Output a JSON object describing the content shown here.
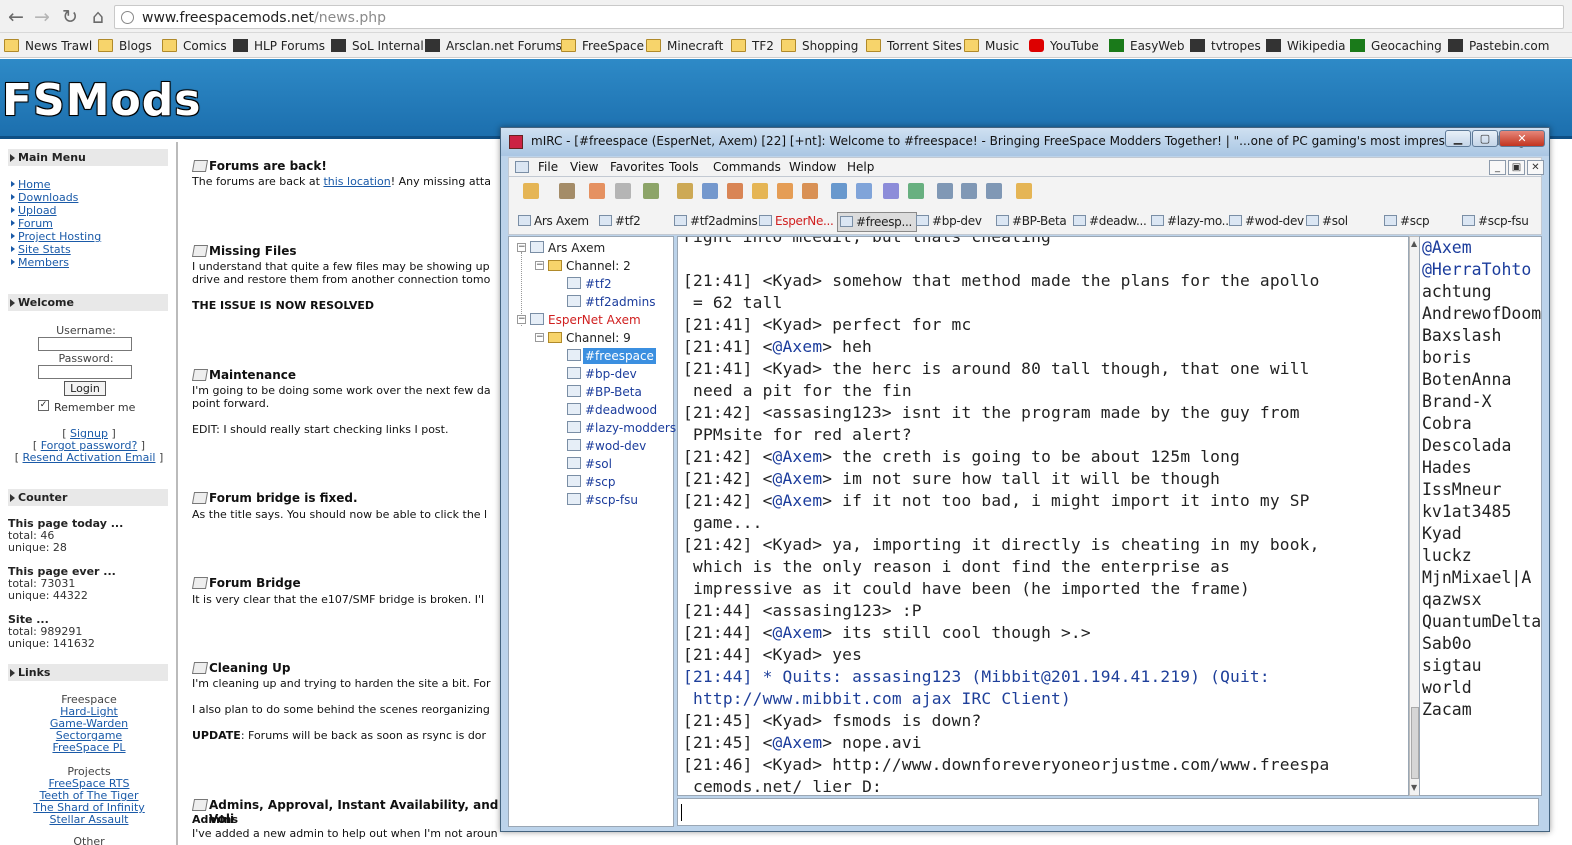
{
  "browser": {
    "url_host": "www.freespacemods.net",
    "url_path": "/news.php",
    "bookmarks": [
      {
        "label": "News Trawl",
        "icon": "folder-icon"
      },
      {
        "label": "Blogs",
        "icon": "folder-icon"
      },
      {
        "label": "Comics",
        "icon": "folder-icon"
      },
      {
        "label": "HLP Forums",
        "icon": "hlp-icon"
      },
      {
        "label": "SoL Internal",
        "icon": "sol-icon"
      },
      {
        "label": "Arsclan.net Forums",
        "icon": "arsclan-icon"
      },
      {
        "label": "FreeSpace",
        "icon": "folder-icon"
      },
      {
        "label": "Minecraft",
        "icon": "folder-icon"
      },
      {
        "label": "TF2",
        "icon": "folder-icon"
      },
      {
        "label": "Shopping",
        "icon": "folder-icon"
      },
      {
        "label": "Torrent Sites",
        "icon": "folder-icon"
      },
      {
        "label": "Music",
        "icon": "folder-icon"
      },
      {
        "label": "YouTube",
        "icon": "youtube-icon"
      },
      {
        "label": "EasyWeb",
        "icon": "td-icon"
      },
      {
        "label": "tvtropes",
        "icon": "tvtropes-icon"
      },
      {
        "label": "Wikipedia",
        "icon": "wikipedia-icon"
      },
      {
        "label": "Geocaching",
        "icon": "geocaching-icon"
      },
      {
        "label": "Pastebin.com",
        "icon": "pastebin-icon"
      }
    ]
  },
  "site": {
    "logo": "FSMods",
    "sidebar": {
      "main_menu_title": "Main Menu",
      "menu": [
        "Home",
        "Downloads",
        "Upload",
        "Forum",
        "Project Hosting",
        "Site Stats",
        "Members"
      ],
      "welcome_title": "Welcome",
      "username_label": "Username:",
      "password_label": "Password:",
      "login_button": "Login",
      "remember_me": "Remember me",
      "signup": "Signup",
      "forgot": "Forgot password?",
      "resend": "Resend Activation Email",
      "counter_title": "Counter",
      "today_label": "This page today ...",
      "today_total": "total: 46",
      "today_unique": "unique: 28",
      "ever_label": "This page ever ...",
      "ever_total": "total: 73031",
      "ever_unique": "unique: 44322",
      "site_label": "Site ...",
      "site_total": "total: 989291",
      "site_unique": "unique: 141632",
      "links_title": "Links",
      "freespace_heading": "Freespace",
      "freespace_links": [
        "Hard-Light",
        "Game-Warden",
        "Sectorgame",
        "FreeSpace PL"
      ],
      "projects_heading": "Projects",
      "project_links": [
        "FreeSpace RTS",
        "Teeth of The Tiger",
        "The Shard of Infinity",
        "Stellar Assault"
      ],
      "other_heading": "Other"
    },
    "news": [
      {
        "title": "Forums are back!",
        "lines": [
          "The forums are back at ",
          "this location",
          "! Any missing atta"
        ]
      },
      {
        "title": "Missing Files",
        "lines": [
          "I understand that quite a few files may be showing up",
          "drive and restore them from another connection tomo",
          "THE ISSUE IS NOW RESOLVED"
        ]
      },
      {
        "title": "Maintenance",
        "lines": [
          "I'm going to be doing some work over the next few da",
          "point forward.",
          "EDIT: I should really start checking links I post."
        ]
      },
      {
        "title": "Forum bridge is fixed.",
        "lines": [
          "As the title says. You should now be able to click the l"
        ]
      },
      {
        "title": "Forum Bridge",
        "lines": [
          "It is very clear that the e107/SMF bridge is broken. I'l"
        ]
      },
      {
        "title": "Cleaning Up",
        "lines": [
          "I'm cleaning up and trying to harden the site a bit. For",
          "I also plan to do some behind the scenes reorganizing",
          "UPDATE",
          ": Forums will be back as soon as rsync is dor"
        ]
      },
      {
        "title": "Admins, Approval, Instant Availability, and Voli",
        "lines": [
          "Admins",
          "I've added a new admin to help out when I'm not aroun"
        ]
      }
    ]
  },
  "mirc": {
    "title": "mIRC - [#freespace (EsperNet, Axem) [22] [+nt]: Welcome to #freespace! - Bringing FreeSpace Modders Together! | \"...one of PC gaming's most impressive modding]",
    "menu": [
      "File",
      "View",
      "Favorites",
      "Tools",
      "Commands",
      "Window",
      "Help"
    ],
    "switchbar": [
      "Ars Axem",
      "#tf2",
      "#tf2admins",
      "EsperNe...",
      "#freesp...",
      "#bp-dev",
      "#BP-Beta",
      "#deadw...",
      "#lazy-mo...",
      "#wod-dev",
      "#sol",
      "#scp",
      "#scp-fsu"
    ],
    "tree": {
      "server1": "Ars Axem",
      "server1_channels_label": "Channel: 2",
      "server1_channels": [
        "#tf2",
        "#tf2admins"
      ],
      "server2": "EsperNet Axem",
      "server2_channels_label": "Channel: 9",
      "server2_channels": [
        "#freespace",
        "#bp-dev",
        "#BP-Beta",
        "#deadwood",
        "#lazy-modders",
        "#wod-dev",
        "#sol",
        "#scp",
        "#scp-fsu"
      ]
    },
    "chat_partial_top": " right into mcedit, but thats cheating",
    "chat": [
      {
        "time": "[21:41]",
        "nick": "<Kyad>",
        "op": false,
        "text": " somehow that method made the plans for the apollo",
        "cont": " = 62 tall"
      },
      {
        "time": "[21:41]",
        "nick": "<Kyad>",
        "op": false,
        "text": " perfect for mc"
      },
      {
        "time": "[21:41]",
        "nick": "<@Axem>",
        "op": true,
        "text": " heh"
      },
      {
        "time": "[21:41]",
        "nick": "<Kyad>",
        "op": false,
        "text": " the herc is around 80 tall though, that one will",
        "cont": " need a pit for the fin"
      },
      {
        "time": "[21:42]",
        "nick": "<assasing123>",
        "op": false,
        "text": " isnt it the program made by the guy from",
        "cont": " PPMsite for red alert?"
      },
      {
        "time": "[21:42]",
        "nick": "<@Axem>",
        "op": true,
        "text": " the creth is going to be about 125m long"
      },
      {
        "time": "[21:42]",
        "nick": "<@Axem>",
        "op": true,
        "text": " im not sure how tall it will be though"
      },
      {
        "time": "[21:42]",
        "nick": "<@Axem>",
        "op": true,
        "text": " if it not too bad, i might import it into my SP",
        "cont": " game..."
      },
      {
        "time": "[21:42]",
        "nick": "<Kyad>",
        "op": false,
        "text": " ya, importing it directly is cheating in my book,",
        "cont": " which is the only reason i dont find the enterprise as",
        "cont2": " impressive as it could have been (he imported the frame)"
      },
      {
        "time": "[21:44]",
        "nick": "<assasing123>",
        "op": false,
        "text": " :P"
      },
      {
        "time": "[21:44]",
        "nick": "<@Axem>",
        "op": true,
        "text": " its still cool though >.>"
      },
      {
        "time": "[21:44]",
        "nick": "<Kyad>",
        "op": false,
        "text": " yes"
      },
      {
        "time": "[21:44]",
        "nick": "",
        "op": false,
        "quit": true,
        "text": " * Quits: assasing123 (Mibbit@201.194.41.219) (Quit:",
        "cont": " http://www.mibbit.com ajax IRC Client)"
      },
      {
        "time": "[21:45]",
        "nick": "<Kyad>",
        "op": false,
        "text": " fsmods is down?"
      },
      {
        "time": "[21:45]",
        "nick": "<@Axem>",
        "op": true,
        "text": " nope.avi"
      },
      {
        "time": "[21:46]",
        "nick": "<Kyad>",
        "op": false,
        "text": " http://www.downforeveryoneorjustme.com/www.freespa",
        "cont": " cemods.net/   lier D:"
      }
    ],
    "nicks": [
      "@Axem",
      "@HerraTohto",
      "achtung",
      "AndrewofDoom",
      "Baxslash",
      "boris",
      "BotenAnna",
      "Brand-X",
      "Cobra",
      "Descolada",
      "Hades",
      "IssMneur",
      "kv1at3485",
      "Kyad",
      "luckz",
      "MjnMixael|A",
      "qazwsx",
      "QuantumDelta",
      "Sab0o",
      "sigtau",
      "world",
      "Zacam"
    ]
  }
}
